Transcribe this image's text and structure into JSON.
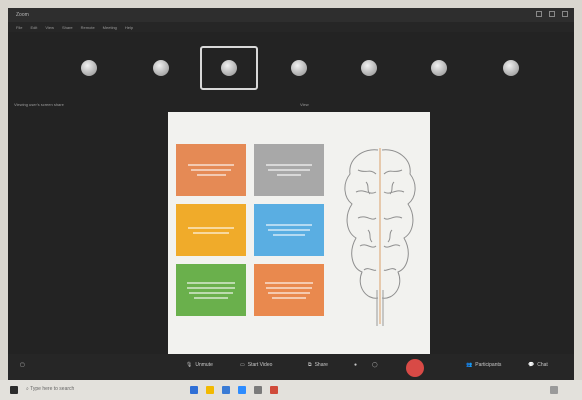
{
  "window": {
    "title": "Zoom",
    "menu": [
      "File",
      "Edit",
      "View",
      "Share",
      "Remote",
      "Meeting",
      "Help"
    ]
  },
  "video_strip": {
    "participants": [
      "",
      "",
      "",
      "",
      "",
      "",
      ""
    ],
    "active_index": 2
  },
  "share": {
    "sharing_label": "Viewing user's screen share",
    "view_label": "View"
  },
  "slide": {
    "boxes": [
      {
        "color": "#e58a55"
      },
      {
        "color": "#a8a8a8"
      },
      {
        "color": "#f0ab2a"
      },
      {
        "color": "#5aaee2"
      },
      {
        "color": "#6ab04c"
      },
      {
        "color": "#e9894e"
      }
    ]
  },
  "toolbar": {
    "unmute": "Unmute",
    "start_video": "Start Video",
    "share": "Share",
    "participants": "Participants",
    "chat": "Chat"
  },
  "taskbar": {
    "search_placeholder": "Type here to search"
  },
  "colors": {
    "background": "#232323",
    "leave_button": "#d84a46",
    "slide_bg": "#f2f2ef"
  }
}
